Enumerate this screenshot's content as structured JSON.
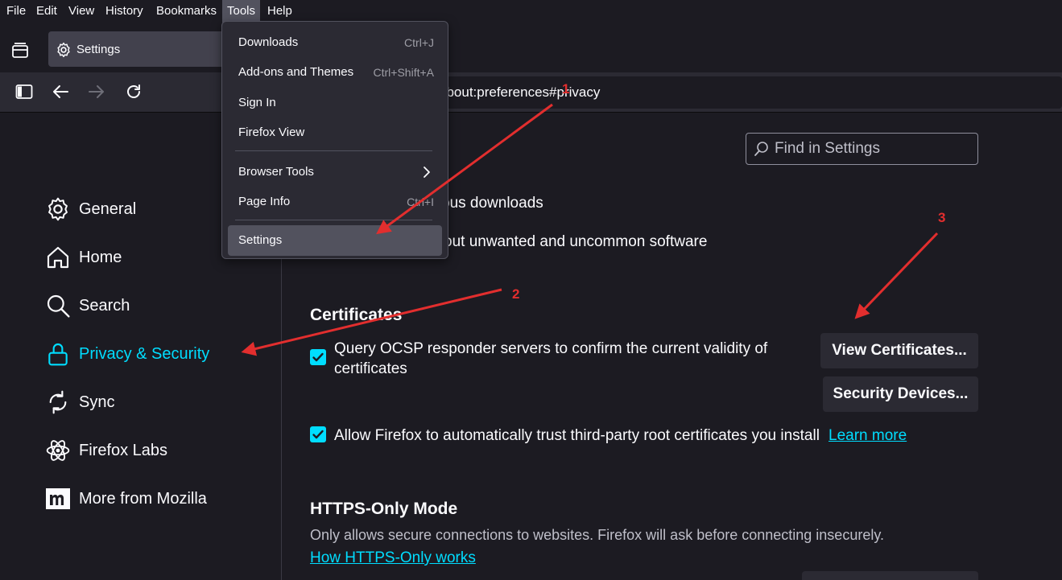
{
  "menubar": {
    "items": [
      "File",
      "Edit",
      "View",
      "History",
      "Bookmarks",
      "Tools",
      "Help"
    ]
  },
  "tab": {
    "title": "Settings"
  },
  "urlbar": {
    "value": "about:preferences#privacy"
  },
  "tools_menu": {
    "items": [
      {
        "label": "Downloads",
        "shortcut": "Ctrl+J"
      },
      {
        "label": "Add-ons and Themes",
        "shortcut": "Ctrl+Shift+A"
      },
      {
        "label": "Sign In",
        "shortcut": ""
      },
      {
        "label": "Firefox View",
        "shortcut": ""
      },
      {
        "label": "Browser Tools",
        "shortcut": ""
      },
      {
        "label": "Page Info",
        "shortcut": "Ctrl+I"
      },
      {
        "label": "Settings",
        "shortcut": ""
      }
    ]
  },
  "sidebar": {
    "items": [
      {
        "label": "General",
        "icon": "gear-icon"
      },
      {
        "label": "Home",
        "icon": "home-icon"
      },
      {
        "label": "Search",
        "icon": "search-icon"
      },
      {
        "label": "Privacy & Security",
        "icon": "lock-icon"
      },
      {
        "label": "Sync",
        "icon": "sync-icon"
      },
      {
        "label": "Firefox Labs",
        "icon": "labs-icon"
      },
      {
        "label": "More from Mozilla",
        "icon": "mozilla-icon"
      }
    ]
  },
  "search": {
    "placeholder": "Find in Settings"
  },
  "partial": {
    "line1": "ous downloads",
    "line2": "out unwanted and uncommon software"
  },
  "certificates": {
    "heading": "Certificates",
    "ocsp_line1": "Query OCSP responder servers to confirm the current validity of",
    "ocsp_line2": "certificates",
    "view_button": "View Certificates...",
    "devices_button": "Security Devices...",
    "trust_label": "Allow Firefox to automatically trust third-party root certificates you install",
    "learn_more": "Learn more"
  },
  "https_only": {
    "heading": "HTTPS-Only Mode",
    "description": "Only allows secure connections to websites. Firefox will ask before connecting insecurely.",
    "link": "How HTTPS-Only works"
  },
  "annotations": {
    "n1": "1",
    "n2": "2",
    "n3": "3"
  },
  "colors": {
    "accent": "#00ddff",
    "annotation": "#e22e2e",
    "background": "#1c1b22"
  }
}
